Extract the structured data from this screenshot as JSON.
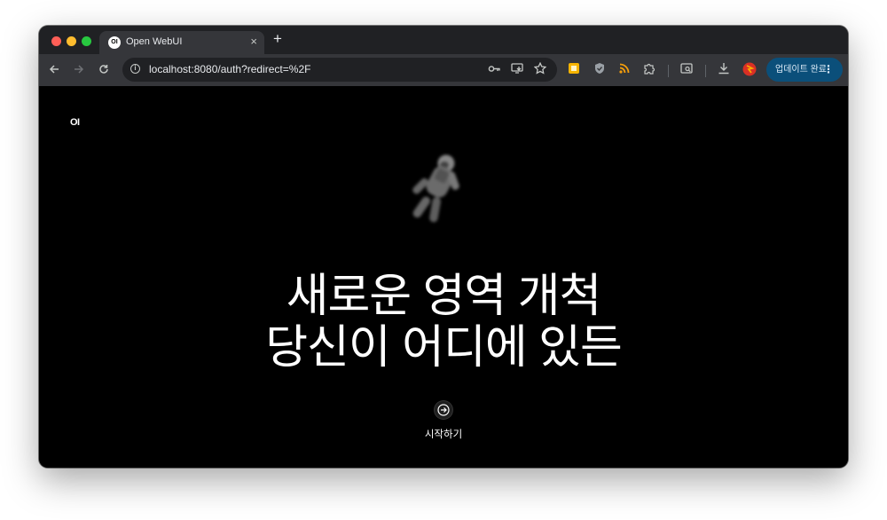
{
  "browser": {
    "tab": {
      "title": "Open WebUI",
      "favicon_text": "OI",
      "close_glyph": "×"
    },
    "new_tab_glyph": "+",
    "url": "localhost:8080/auth?redirect=%2F",
    "update_button_label": "업데이트 완료",
    "icons": [
      "back-arrow-icon",
      "forward-arrow-icon",
      "reload-icon",
      "site-info-icon",
      "password-key-icon",
      "install-app-icon",
      "bookmark-star-icon",
      "extension-yellow-icon",
      "extension-shield-icon",
      "rss-icon",
      "extensions-puzzle-icon",
      "tab-search-icon",
      "download-icon",
      "profile-avatar-icon",
      "more-menu-icon"
    ]
  },
  "page": {
    "logo_text": "OI",
    "headline_line1": "새로운 영역 개척",
    "headline_line2": "당신이 어디에 있든",
    "start_label": "시작하기"
  },
  "colors": {
    "tab_strip": "#202124",
    "toolbar": "#35363a",
    "page_background": "#000000",
    "update_button": "#0b4f7a",
    "text": "#ffffff"
  }
}
